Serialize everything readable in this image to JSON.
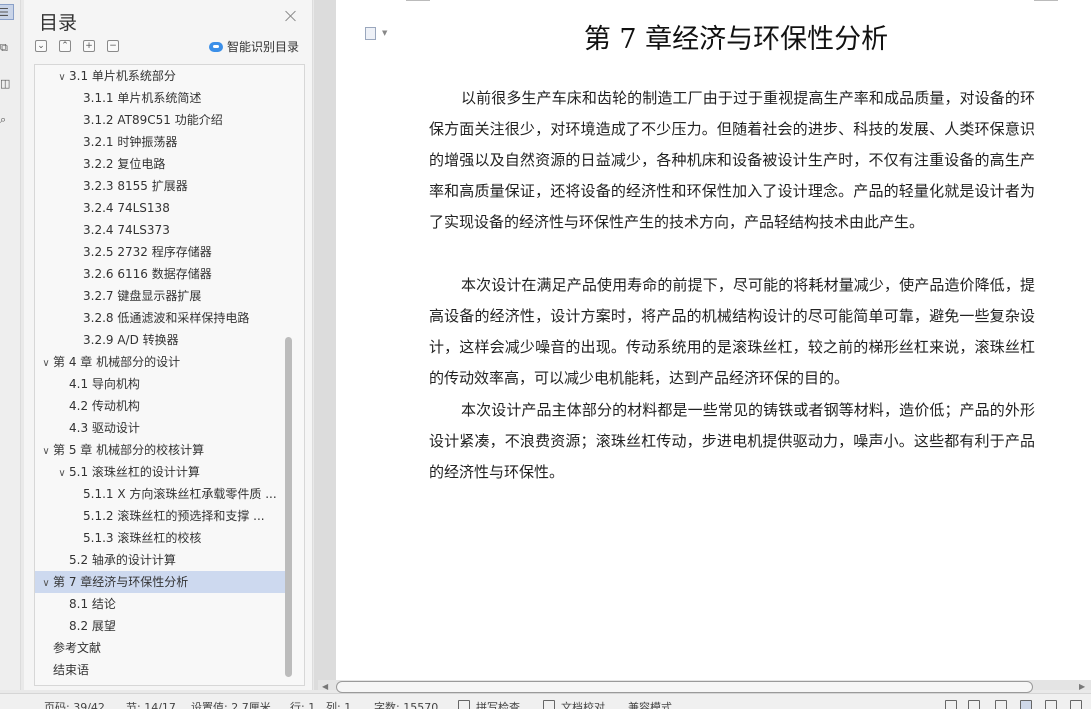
{
  "toc_panel": {
    "title": "目录",
    "smart_label": "智能识别目录",
    "toolbar_icons": [
      "collapse-all-icon",
      "expand-up-icon",
      "add-heading-icon",
      "remove-heading-icon"
    ],
    "items": [
      {
        "label": "3.1 单片机系统部分",
        "level": 2,
        "expanded": true
      },
      {
        "label": "3.1.1 单片机系统简述",
        "level": 3
      },
      {
        "label": "3.1.2 AT89C51 功能介绍",
        "level": 3
      },
      {
        "label": "3.2.1 时钟振荡器",
        "level": 3
      },
      {
        "label": "3.2.2 复位电路",
        "level": 3
      },
      {
        "label": "3.2.3 8155 扩展器",
        "level": 3
      },
      {
        "label": "3.2.4 74LS138",
        "level": 3
      },
      {
        "label": "3.2.4 74LS373",
        "level": 3
      },
      {
        "label": "3.2.5 2732 程序存储器",
        "level": 3
      },
      {
        "label": "3.2.6 6116 数据存储器",
        "level": 3
      },
      {
        "label": "3.2.7  键盘显示器扩展",
        "level": 3
      },
      {
        "label": "3.2.8  低通滤波和采样保持电路",
        "level": 3
      },
      {
        "label": "3.2.9 A/D 转换器",
        "level": 3
      },
      {
        "label": "第 4 章  机械部分的设计",
        "level": 1,
        "expanded": true
      },
      {
        "label": "4.1 导向机构",
        "level": 2
      },
      {
        "label": "4.2 传动机构",
        "level": 2
      },
      {
        "label": "4.3  驱动设计",
        "level": 2
      },
      {
        "label": "第 5 章  机械部分的校核计算",
        "level": 1,
        "expanded": true
      },
      {
        "label": "5.1 滚珠丝杠的设计计算",
        "level": 2,
        "expanded": true
      },
      {
        "label": "5.1.1 X 方向滚珠丝杠承载零件质 ...",
        "level": 3
      },
      {
        "label": "5.1.2  滚珠丝杠的预选择和支撑 ...",
        "level": 3
      },
      {
        "label": "5.1.3  滚珠丝杠的校核",
        "level": 3
      },
      {
        "label": "5.2 轴承的设计计算",
        "level": 2
      },
      {
        "label": "第 7 章经济与环保性分析",
        "level": 1,
        "expanded": true,
        "selected": true
      },
      {
        "label": "8.1 结论",
        "level": 2
      },
      {
        "label": "8.2  展望",
        "level": 2
      },
      {
        "label": "参考文献",
        "level": 1
      },
      {
        "label": "结束语",
        "level": 1
      }
    ]
  },
  "document": {
    "chapter_title": "第 7 章经济与环保性分析",
    "paragraphs": [
      "以前很多生产车床和齿轮的制造工厂由于过于重视提高生产率和成品质量，对设备的环保方面关注很少，对环境造成了不少压力。但随着社会的进步、科技的发展、人类环保意识的增强以及自然资源的日益减少，各种机床和设备被设计生产时，不仅有注重设备的高生产率和高质量保证，还将设备的经济性和环保性加入了设计理念。产品的轻量化就是设计者为了实现设备的经济性与环保性产生的技术方向，产品轻结构技术由此产生。",
      "本次设计在满足产品使用寿命的前提下，尽可能的将耗材量减少，使产品造价降低，提高设备的经济性，设计方案时，将产品的机械结构设计的尽可能简单可靠，避免一些复杂设计，这样会减少噪音的出现。传动系统用的是滚珠丝杠，较之前的梯形丝杠来说，滚珠丝杠的传动效率高，可以减少电机能耗，达到产品经济环保的目的。",
      "本次设计产品主体部分的材料都是一些常见的铸铁或者钢等材料，造价低；产品的外形设计紧凑，不浪费资源；滚珠丝杠传动，步进电机提供驱动力，噪声小。这些都有利于产品的经济性与环保性。"
    ]
  },
  "status_bar": {
    "page_num": "页码: 39/42",
    "section": "节: 14/17",
    "setting": "设置值: 2.7厘米",
    "row": "行: 1",
    "col": "列: 1",
    "word_count": "字数: 15570",
    "spell_check": "拼写检查",
    "doc_check": "文档校对",
    "mode": "兼容模式"
  }
}
